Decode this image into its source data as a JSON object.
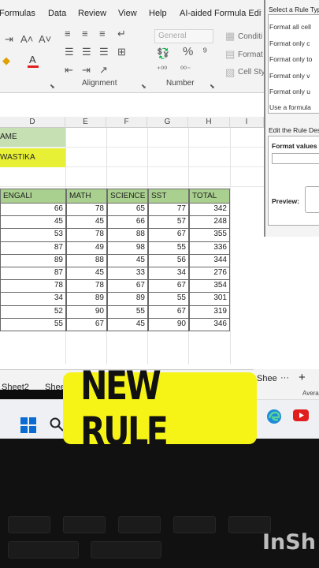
{
  "ribbon": {
    "tabs": [
      "Formulas",
      "Data",
      "Review",
      "View",
      "Help",
      "AI-aided Formula Edit"
    ],
    "number_format": "General",
    "groups": {
      "alignment": "Alignment",
      "number": "Number"
    },
    "styles": {
      "conditional": "Conditi",
      "format_as": "Format",
      "cell_styles": "Cell Sty"
    }
  },
  "columns": [
    "D",
    "E",
    "F",
    "G",
    "H",
    "I"
  ],
  "name_block": {
    "label": "AME",
    "value": "WASTIKA"
  },
  "table": {
    "headers": [
      "ENGALI",
      "MATH",
      "SCIENCE",
      "SST",
      "TOTAL"
    ],
    "rows": [
      [
        "66",
        "78",
        "65",
        "77",
        "342"
      ],
      [
        "45",
        "45",
        "66",
        "57",
        "248"
      ],
      [
        "53",
        "78",
        "88",
        "67",
        "355"
      ],
      [
        "87",
        "49",
        "98",
        "55",
        "336"
      ],
      [
        "89",
        "88",
        "45",
        "56",
        "344"
      ],
      [
        "87",
        "45",
        "33",
        "34",
        "276"
      ],
      [
        "78",
        "78",
        "67",
        "67",
        "354"
      ],
      [
        "34",
        "89",
        "89",
        "55",
        "301"
      ],
      [
        "52",
        "90",
        "55",
        "67",
        "319"
      ],
      [
        "55",
        "67",
        "45",
        "90",
        "346"
      ]
    ]
  },
  "sheet_tabs": {
    "left": "Sheet2",
    "middle": "Shee",
    "right": "Shee",
    "more": "···",
    "add": "+",
    "status": "Avera"
  },
  "rule_dialog": {
    "select_label": "Select a Rule Type",
    "options": [
      "Format all cell",
      "Format only c",
      "Format only to",
      "Format only v",
      "Format only u",
      "Use a formula"
    ],
    "edit_label": "Edit the Rule Desc",
    "format_values": "Format values v",
    "preview": "Preview:"
  },
  "banner": {
    "text": "NEW RULE"
  },
  "watermark": {
    "text": "InSh"
  },
  "icons": [
    "search-icon",
    "windows-start-icon",
    "edge-icon",
    "youtube-icon",
    "percent-icon",
    "currency-icon"
  ],
  "colors": {
    "header_green": "#a9d08e",
    "name_green": "#c6e0b4",
    "highlight_yellow": "#e8f035",
    "banner_yellow": "#f6f317"
  }
}
